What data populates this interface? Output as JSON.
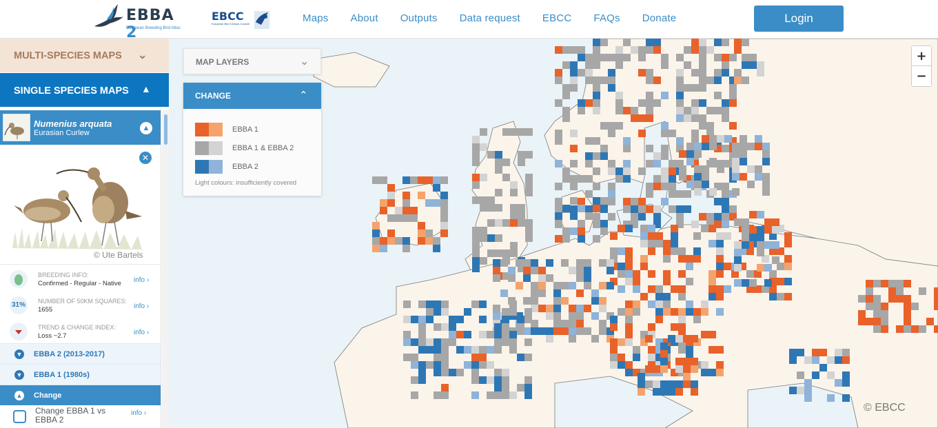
{
  "header": {
    "logo_text": "EBBA",
    "logo_num": "2",
    "logo_sub": "European Breeding Bird Atlas",
    "ebcc_text": "EBCC",
    "ebcc_sub": "European Bird Census Council",
    "nav": [
      "Maps",
      "About",
      "Outputs",
      "Data request",
      "EBCC",
      "FAQs",
      "Donate"
    ],
    "login_label": "Login"
  },
  "sidebar": {
    "multi_species": "MULTI-SPECIES MAPS",
    "single_species": "SINGLE SPECIES MAPS",
    "species": {
      "scientific": "Numenius arquata",
      "common": "Eurasian Curlew",
      "credit": "© Ute Bartels"
    },
    "info": [
      {
        "label": "BREEDING INFO:",
        "value": "Confirmed - Regular - Native",
        "more": "info ›",
        "icon": "egg-icon"
      },
      {
        "label": "NUMBER OF 50KM SQUARES:",
        "value": "1655",
        "more": "info ›",
        "icon": "percent-badge",
        "badge": "31%"
      },
      {
        "label": "TREND & CHANGE INDEX:",
        "value": "Loss −2.7",
        "more": "info ›",
        "icon": "trend-down-icon"
      }
    ],
    "sections": [
      {
        "label": "EBBA 2 (2013-2017)"
      },
      {
        "label": "EBBA 1 (1980s)"
      },
      {
        "label": "Change"
      }
    ],
    "change_option": {
      "label": "Change EBBA 1 vs EBBA 2",
      "more": "info ›"
    }
  },
  "map": {
    "layers_label": "MAP LAYERS",
    "change_label": "CHANGE",
    "legend": [
      {
        "label": "EBBA 1",
        "colors": [
          "#e8622a",
          "#f4a36c"
        ]
      },
      {
        "label": "EBBA 1 & EBBA 2",
        "colors": [
          "#a7a7a7",
          "#d3d3d3"
        ]
      },
      {
        "label": "EBBA 2",
        "colors": [
          "#2e77b5",
          "#8fb3d9"
        ]
      }
    ],
    "legend_note": "Light colours: insufficiently covered",
    "zoom_in": "+",
    "zoom_out": "−",
    "copyright": "© EBCC"
  }
}
